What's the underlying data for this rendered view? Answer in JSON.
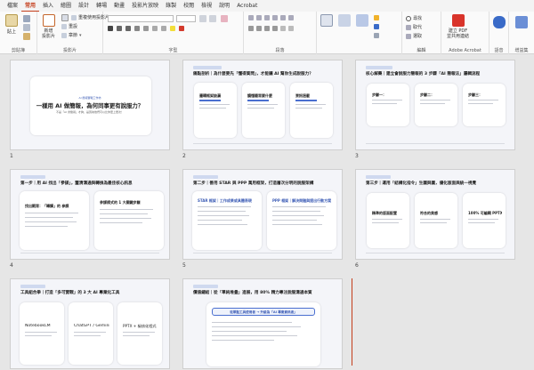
{
  "menu": [
    "檔案",
    "常用",
    "插入",
    "繪圖",
    "設計",
    "轉場",
    "動畫",
    "投影片放映",
    "錄製",
    "校閱",
    "檢視",
    "說明",
    "Acrobat"
  ],
  "menu_active": 1,
  "ribbon": {
    "new_slide": "新增\n投影片",
    "reset": "重設",
    "section": "章節",
    "reuse": "重複使用投影片",
    "groups": {
      "clipboard": "剪貼簿",
      "slides": "投影片",
      "font": "字型",
      "paragraph": "段落",
      "editing": "編輯",
      "acrobat": "Adobe Acrobat",
      "voice": "語音",
      "addins": "增益集"
    },
    "find": "尋找",
    "replace": "取代",
    "select": "選取",
    "pdf_button": "建立 PDF\n並共用連結",
    "paste": "貼上"
  },
  "slides": [
    {
      "num": "1",
      "title": "一樣用 AI 做簡報，為何同事更有說服力？",
      "subtitle": "不是「AI 會簡報」才夠，是因為他們可以比你更上層次！",
      "tag": "AI 簡報實戰工作坊"
    },
    {
      "num": "2",
      "title": "痛點剖析｜為什麼要先「懂得質問」，才能讓 AI 幫你生成說服力？",
      "cards": [
        "邏輯框架缺漏",
        "讀懂聽眾要什麼",
        "資訊過載"
      ]
    },
    {
      "num": "3",
      "title": "核心解藥｜建立會說服力簡報的 3 步驟「AI 簡報法」邏輯流程",
      "cards": [
        "步驟一：",
        "步驟二：",
        "步驟三："
      ]
    },
    {
      "num": "4",
      "title": "第一步｜用 AI 找出「參謀」，釐清溝通與轉換為最佳核心訊息",
      "cards": [
        "找出觀眾：「轉譯」的 参謀",
        "參謀模式的 1 大關鍵步驟"
      ]
    },
    {
      "num": "5",
      "title": "第二步｜善用 STAR 與 PPP 萬用框架，打造層次分明的說服架構",
      "cards": [
        "STAR 框架｜工作成果或具體表現",
        "PPP 框架｜解決問題與提出行動方案"
      ]
    },
    {
      "num": "6",
      "title": "第三步｜運用「結構化指令」生圖與圖，優化版面與統一視覺",
      "cards": [
        "精準的版面配置",
        "符合的美感",
        "100% 可編輯 PPTX 檔"
      ]
    },
    {
      "num": "7",
      "title": "工具組合拳｜打造「多可實戰」的 3 大 AI 專業化工具",
      "cards": [
        "NotebookLM",
        "ChatGPT / Gemini",
        "PPTX + 檢核化程式"
      ]
    },
    {
      "num": "8",
      "title": "價值總結｜從「單純堆疊」進展，用 80% 精力專注說服溝通本質",
      "cards": [
        "從單點工具使用者 → 升級為「AI 專業資訊者」"
      ]
    }
  ]
}
